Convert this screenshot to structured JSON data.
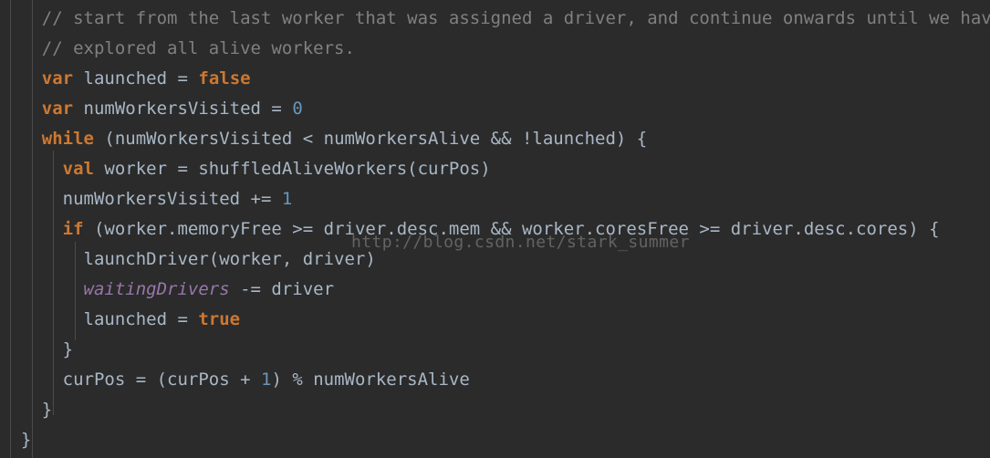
{
  "editor": {
    "background_color": "#2b2b2b",
    "default_text_color": "#a9b7c6",
    "comment_color": "#808080",
    "keyword_color": "#cc7832",
    "number_color": "#6897bb",
    "field_color": "#9876aa",
    "indent_guide_color": "#4b4b4b"
  },
  "watermark": {
    "text": "http://blog.csdn.net/stark_summer"
  },
  "code": {
    "language": "scala",
    "lines": [
      {
        "indent": "    ",
        "tokens": [
          {
            "text": "// start from the last worker that was assigned a driver, and continue onwards until we have",
            "type": "comment"
          }
        ]
      },
      {
        "indent": "    ",
        "tokens": [
          {
            "text": "// explored all alive workers.",
            "type": "comment"
          }
        ]
      },
      {
        "indent": "    ",
        "tokens": [
          {
            "text": "var",
            "type": "keyword"
          },
          {
            "text": " launched = ",
            "type": "default"
          },
          {
            "text": "false",
            "type": "keyword"
          }
        ]
      },
      {
        "indent": "    ",
        "tokens": [
          {
            "text": "var",
            "type": "keyword"
          },
          {
            "text": " numWorkersVisited = ",
            "type": "default"
          },
          {
            "text": "0",
            "type": "number"
          }
        ]
      },
      {
        "indent": "    ",
        "tokens": [
          {
            "text": "while",
            "type": "keyword"
          },
          {
            "text": " (numWorkersVisited < numWorkersAlive && !launched) {",
            "type": "default"
          }
        ]
      },
      {
        "indent": "      ",
        "tokens": [
          {
            "text": "val",
            "type": "keyword"
          },
          {
            "text": " worker = shuffledAliveWorkers(curPos)",
            "type": "default"
          }
        ]
      },
      {
        "indent": "      ",
        "tokens": [
          {
            "text": "numWorkersVisited += ",
            "type": "default"
          },
          {
            "text": "1",
            "type": "number"
          }
        ]
      },
      {
        "indent": "      ",
        "tokens": [
          {
            "text": "if",
            "type": "keyword"
          },
          {
            "text": " (worker.memoryFree >= driver.desc.mem && worker.coresFree >= driver.desc.cores) {",
            "type": "default"
          }
        ]
      },
      {
        "indent": "        ",
        "tokens": [
          {
            "text": "launchDriver(worker, driver)",
            "type": "default"
          }
        ]
      },
      {
        "indent": "        ",
        "tokens": [
          {
            "text": "waitingDrivers",
            "type": "field"
          },
          {
            "text": " -= driver",
            "type": "default"
          }
        ]
      },
      {
        "indent": "        ",
        "tokens": [
          {
            "text": "launched = ",
            "type": "default"
          },
          {
            "text": "true",
            "type": "keyword"
          }
        ]
      },
      {
        "indent": "      ",
        "tokens": [
          {
            "text": "}",
            "type": "brace"
          }
        ]
      },
      {
        "indent": "      ",
        "tokens": [
          {
            "text": "curPos = (curPos + ",
            "type": "default"
          },
          {
            "text": "1",
            "type": "number"
          },
          {
            "text": ") % numWorkersAlive",
            "type": "default"
          }
        ]
      },
      {
        "indent": "    ",
        "tokens": [
          {
            "text": "}",
            "type": "brace"
          }
        ]
      },
      {
        "indent": "  ",
        "tokens": [
          {
            "text": "}",
            "type": "brace"
          }
        ]
      }
    ]
  }
}
